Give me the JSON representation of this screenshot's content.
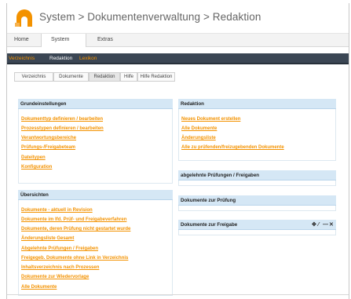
{
  "header": {
    "title": "System > Dokumentenverwaltung > Redaktion"
  },
  "main_nav": {
    "items": [
      "Home",
      "System",
      "Extras"
    ],
    "active": "System"
  },
  "sub_nav": {
    "items": [
      "Verzeichnis",
      "Redaktion",
      "Lexikon"
    ],
    "colors": {
      "inactive": "#f39200",
      "active": "#ffffff",
      "bar": "#3b4654"
    }
  },
  "tabs": {
    "items": [
      "Verzeichnis",
      "Dokumente",
      "Redaktion",
      "Hilfe",
      "Hilfe Redaktion"
    ],
    "selected": "Redaktion"
  },
  "panels": {
    "grundeinstellungen": {
      "title": "Grundeinstellungen",
      "links": [
        "Dokumenttyp definieren / bearbeiten",
        "Prozesstypen definieren / bearbeiten",
        "Verantwortungsbereiche",
        "Prüfungs-/Freigabeteam",
        "Dateitypen",
        "Konfiguration"
      ]
    },
    "uebersichten": {
      "title": "Übersichten",
      "links": [
        "Dokumente - aktuell in Revision",
        "Dokumente im lfd. Prüf- und Freigabeverfahren",
        "Dokumente, deren Prüfung nicht gestartet wurde",
        "Änderungsliste Gesamt",
        "Abgelehnte Prüfungen / Freigaben",
        "Freigegeb. Dokumente ohne Link in Verzeichnis",
        "Inhaltsverzeichnis nach Prozessen",
        "Dokumente zur Wiedervorlage",
        "Alle Dokumente"
      ]
    },
    "redaktion": {
      "title": "Redaktion",
      "links": [
        "Neues Dokument erstellen",
        "Alle Dokumente",
        "Änderungsliste",
        "Alle zu prüfenden/freizugebenden Dokumente"
      ]
    },
    "abgelehnte": {
      "title": "abgelehnte Prüfungen / Freigaben"
    },
    "zur_pruefung": {
      "title": "Dokumente zur Prüfung"
    },
    "zur_freigabe": {
      "title": "Dokumente zur Freigabe",
      "controls": [
        "✥",
        "⁄",
        "—",
        "✕"
      ]
    }
  },
  "accent": "#f39200",
  "panel_header_bg": "#d5e7f5"
}
